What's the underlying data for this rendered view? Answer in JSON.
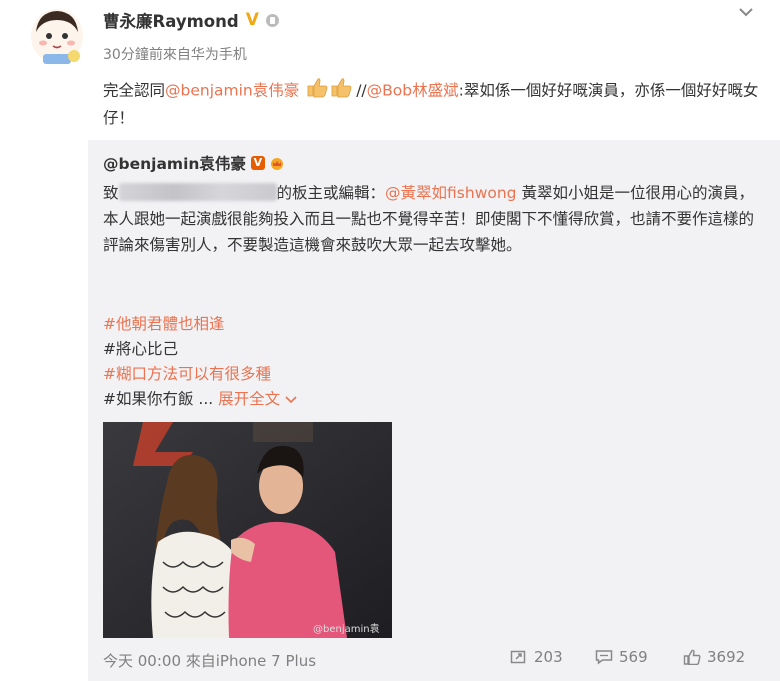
{
  "post": {
    "author": "曹永廉Raymond",
    "verified_badge": "V",
    "meta": "30分鐘前來自华为手机",
    "text_prefix": "完全認同",
    "mention_1": "@benjamin袁伟豪",
    "text_sep": "//",
    "mention_2": "@Bob林盛斌",
    "text_suffix": ":翠如係一個好好嘅演員，亦係一個好好嘅女仔！"
  },
  "original": {
    "author": "@benjamin袁伟豪",
    "verified_badge": "V",
    "text_1": "致",
    "text_2": "的板主或編輯：",
    "mention": "@黃翠如fishwong",
    "text_3": " 黃翠如小姐是一位很用心的演員，本人跟她一起演戲很能夠投入而且一點也不覺得辛苦！即使閣下不懂得欣賞，也請不要作這樣的評論來傷害別人，不要製造這機會來鼓吹大眾一起去攻擊她。",
    "tags": [
      "#他朝君體也相逢",
      "#將心比己",
      "#糊口方法可以有很多種",
      "#如果你冇飯 ..."
    ],
    "expand_label": "展开全文",
    "photo_watermark": "@benjamin袁"
  },
  "footer": {
    "time_source": "今天 00:00 來自iPhone 7 Plus",
    "reposts": "203",
    "comments": "569",
    "likes": "3692"
  },
  "colors": {
    "accent": "#eb7350",
    "verified_gold": "#f0a814",
    "repost_bg": "#f2f2f5",
    "meta_gray": "#808080"
  },
  "icons": [
    "chevron-down-icon",
    "level-icon",
    "thumbs-up-icon",
    "verified-icon",
    "crown-icon",
    "repost-icon",
    "comment-icon",
    "like-icon"
  ]
}
